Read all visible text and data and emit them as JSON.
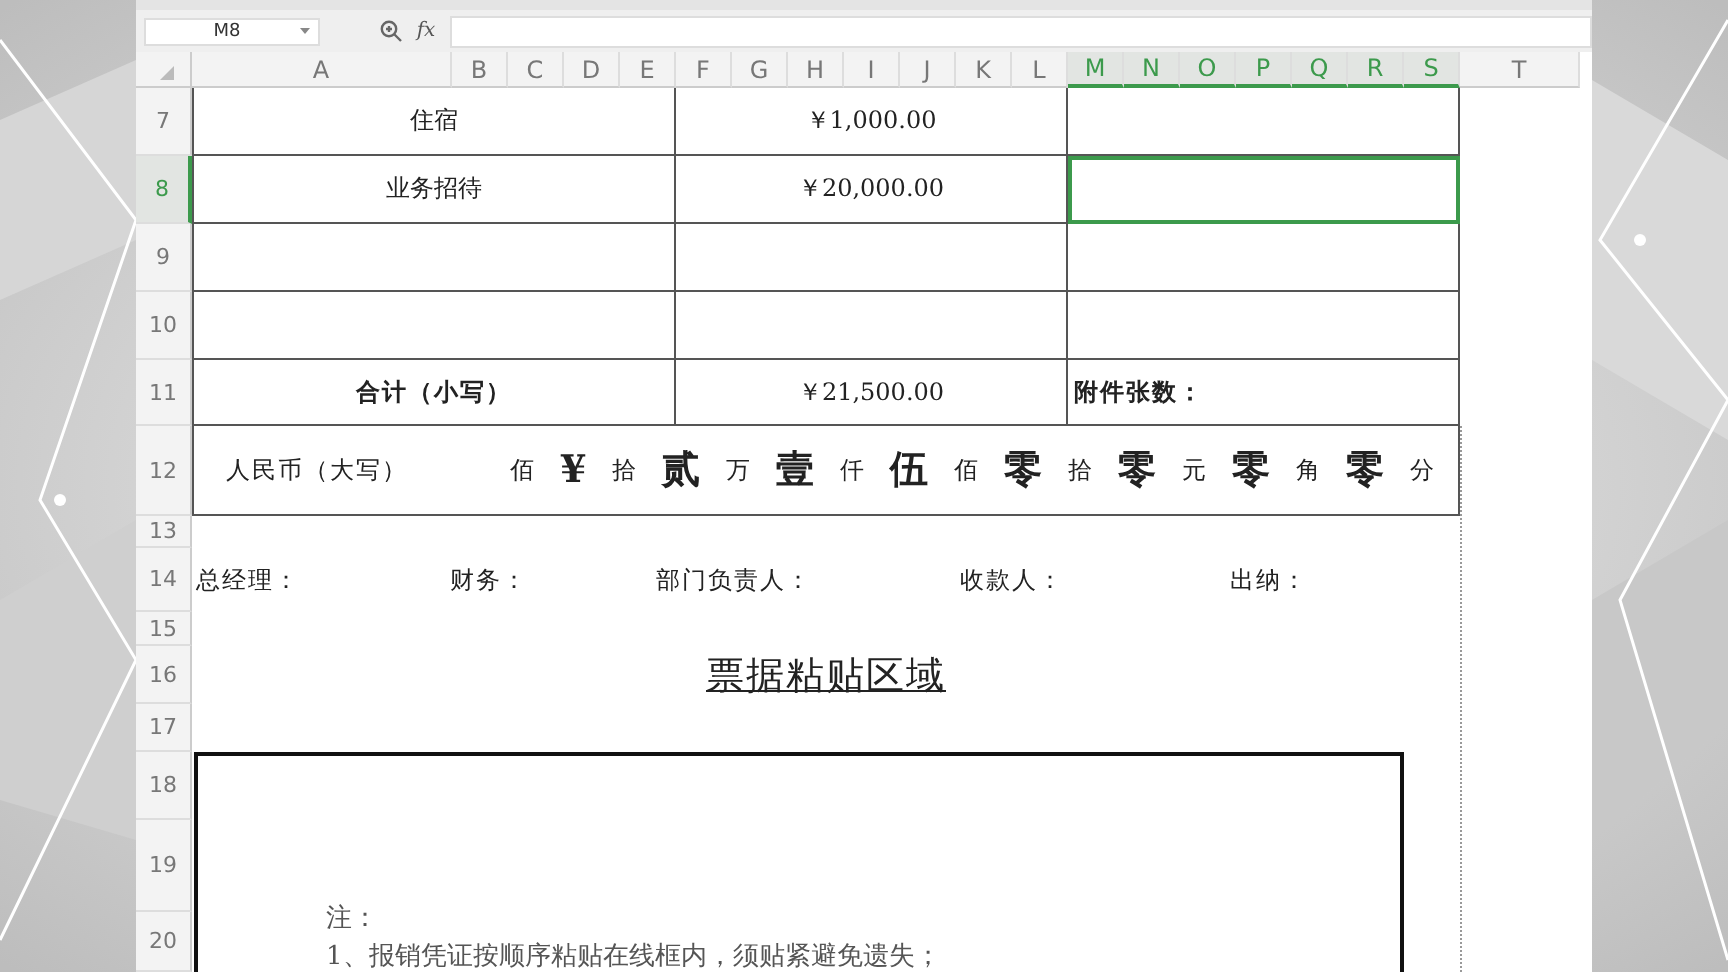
{
  "formula_bar": {
    "name_box": "M8",
    "function_label": "fx"
  },
  "columns": [
    {
      "label": "A",
      "selected": false
    },
    {
      "label": "B",
      "selected": false
    },
    {
      "label": "C",
      "selected": false
    },
    {
      "label": "D",
      "selected": false
    },
    {
      "label": "E",
      "selected": false
    },
    {
      "label": "F",
      "selected": false
    },
    {
      "label": "G",
      "selected": false
    },
    {
      "label": "H",
      "selected": false
    },
    {
      "label": "I",
      "selected": false
    },
    {
      "label": "J",
      "selected": false
    },
    {
      "label": "K",
      "selected": false
    },
    {
      "label": "L",
      "selected": false
    },
    {
      "label": "M",
      "selected": true
    },
    {
      "label": "N",
      "selected": true
    },
    {
      "label": "O",
      "selected": true
    },
    {
      "label": "P",
      "selected": true
    },
    {
      "label": "Q",
      "selected": true
    },
    {
      "label": "R",
      "selected": true
    },
    {
      "label": "S",
      "selected": true
    },
    {
      "label": "T",
      "selected": false
    }
  ],
  "rows": [
    {
      "label": "7",
      "selected": false
    },
    {
      "label": "8",
      "selected": true
    },
    {
      "label": "9",
      "selected": false
    },
    {
      "label": "10",
      "selected": false
    },
    {
      "label": "11",
      "selected": false
    },
    {
      "label": "12",
      "selected": false
    },
    {
      "label": "13",
      "selected": false
    },
    {
      "label": "14",
      "selected": false
    },
    {
      "label": "15",
      "selected": false
    },
    {
      "label": "16",
      "selected": false
    },
    {
      "label": "17",
      "selected": false
    },
    {
      "label": "18",
      "selected": false
    },
    {
      "label": "19",
      "selected": false
    },
    {
      "label": "20",
      "selected": false
    }
  ],
  "expense_rows": [
    {
      "item": "住宿",
      "amount": "￥1,000.00",
      "selected": false
    },
    {
      "item": "业务招待",
      "amount": "￥20,000.00",
      "selected": true
    },
    {
      "selected": false
    },
    {
      "selected": false
    }
  ],
  "total": {
    "label": "合计（小写）",
    "amount": "￥21,500.00",
    "attachments_label": "附件张数："
  },
  "uppercase": {
    "label": "人民币（大写）",
    "parts": [
      {
        "kind": "unit",
        "text": "佰"
      },
      {
        "kind": "digit",
        "text": "¥"
      },
      {
        "kind": "unit",
        "text": "拾"
      },
      {
        "kind": "digit",
        "text": "贰"
      },
      {
        "kind": "unit",
        "text": "万"
      },
      {
        "kind": "digit",
        "text": "壹"
      },
      {
        "kind": "unit",
        "text": "仟"
      },
      {
        "kind": "digit",
        "text": "伍"
      },
      {
        "kind": "unit",
        "text": "佰"
      },
      {
        "kind": "digit",
        "text": "零"
      },
      {
        "kind": "unit",
        "text": "拾"
      },
      {
        "kind": "digit",
        "text": "零"
      },
      {
        "kind": "unit",
        "text": "元"
      },
      {
        "kind": "digit",
        "text": "零"
      },
      {
        "kind": "unit",
        "text": "角"
      },
      {
        "kind": "digit",
        "text": "零"
      },
      {
        "kind": "unit",
        "text": "分"
      }
    ]
  },
  "signatures": [
    "总经理：",
    "财务：",
    "部门负责人：",
    "收款人：",
    "出纳："
  ],
  "paste_area": {
    "title": "票据粘贴区域",
    "note_label": "注：",
    "notes": [
      "1、报销凭证按顺序粘贴在线框内，须贴紧避免遗失；"
    ]
  }
}
